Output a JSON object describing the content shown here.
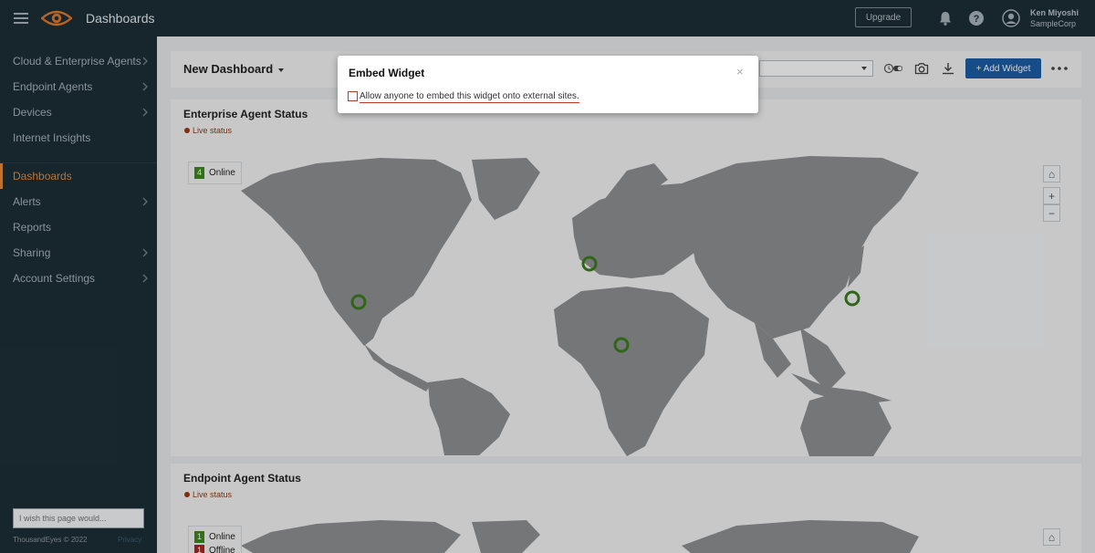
{
  "topbar": {
    "app_title": "Dashboards",
    "upgrade_label": "Upgrade",
    "user_name": "Ken Miyoshi",
    "user_org": "SampleCorp",
    "icons": [
      "menu-icon",
      "eye-logo-icon",
      "bell-icon",
      "help-icon",
      "user-avatar-icon"
    ]
  },
  "sidebar": {
    "items": [
      {
        "label": "Cloud & Enterprise Agents",
        "has_children": true
      },
      {
        "label": "Endpoint Agents",
        "has_children": true
      },
      {
        "label": "Devices",
        "has_children": true
      },
      {
        "label": "Internet Insights",
        "has_children": false
      },
      {
        "label": "Dashboards",
        "has_children": false,
        "active": true
      },
      {
        "label": "Alerts",
        "has_children": true
      },
      {
        "label": "Reports",
        "has_children": false
      },
      {
        "label": "Sharing",
        "has_children": true
      },
      {
        "label": "Account Settings",
        "has_children": true
      }
    ],
    "feedback_placeholder": "I wish this page would...",
    "copyright": "ThousandEyes © 2022",
    "privacy": "Privacy"
  },
  "dashboard": {
    "title": "New Dashboard",
    "add_widget_label": "+ Add Widget",
    "header_icons": [
      "live-toggle-icon",
      "camera-icon",
      "download-icon",
      "more-icon"
    ]
  },
  "widgets": [
    {
      "title": "Enterprise Agent Status",
      "live_label": "Live status",
      "legend": [
        {
          "count": "4",
          "label": "Online",
          "status": "online"
        }
      ]
    },
    {
      "title": "Endpoint Agent Status",
      "live_label": "Live status",
      "legend": [
        {
          "count": "1",
          "label": "Online",
          "status": "online"
        },
        {
          "count": "1",
          "label": "Offline",
          "status": "offline"
        }
      ]
    }
  ],
  "map_controls": {
    "home": "⌂",
    "zoom_in": "+",
    "zoom_out": "−"
  },
  "modal": {
    "title": "Embed Widget",
    "close": "×",
    "checkbox_label": "Allow anyone to embed this widget onto external sites.",
    "checked": false
  },
  "colors": {
    "nav_bg": "#1d2f38",
    "accent": "#e98b3a",
    "primary_button": "#1b5ea6",
    "online": "#3c8b1f",
    "offline": "#b2241d",
    "live": "#9a3a12"
  }
}
